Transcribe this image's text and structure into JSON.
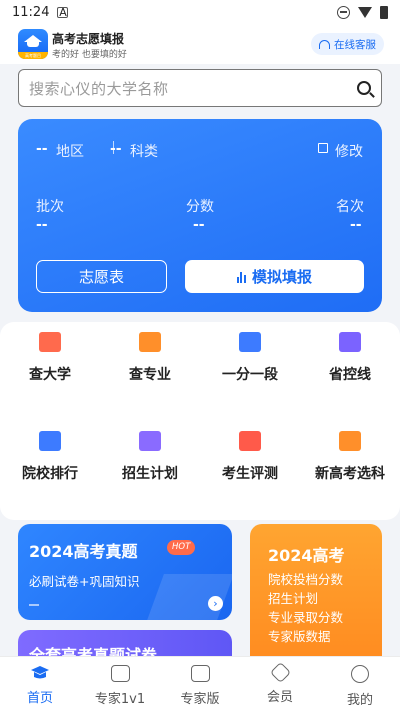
{
  "status_bar": {
    "time": "11:24",
    "badge": "A"
  },
  "header": {
    "title": "高考志愿填报",
    "slogan": "考的好 也要填的好",
    "service_label": "在线客服",
    "logo_ribbon": "高考题目"
  },
  "search": {
    "placeholder": "搜索心仪的大学名称"
  },
  "profile": {
    "region_value": "--",
    "region_label": "地区",
    "subject_value": "--",
    "subject_label": "科类",
    "edit_label": "修改",
    "batch_label": "批次",
    "batch_value": "--",
    "score_label": "分数",
    "score_value": "--",
    "rank_label": "名次",
    "rank_value": "--",
    "wish_button": "志愿表",
    "simulate_button": "模拟填报"
  },
  "features": [
    {
      "label": "查大学",
      "icon": "university-icon",
      "color": "#ff6a4d"
    },
    {
      "label": "查专业",
      "icon": "book-icon",
      "color": "#ff8f2a"
    },
    {
      "label": "一分一段",
      "icon": "segments-icon",
      "color": "#3d7bff"
    },
    {
      "label": "省控线",
      "icon": "monitor-chart-icon",
      "color": "#7b63ff"
    },
    {
      "label": "院校排行",
      "icon": "ranking-icon",
      "color": "#3d7bff"
    },
    {
      "label": "招生计划",
      "icon": "plan-icon",
      "color": "#8a6bff"
    },
    {
      "label": "考生评测",
      "icon": "cube-icon",
      "color": "#ff5a4a"
    },
    {
      "label": "新高考选科",
      "icon": "book-select-icon",
      "color": "#ff8f2a"
    }
  ],
  "promos": {
    "exam": {
      "title": "2024高考真题",
      "badge": "HOT",
      "subtitle": "必刷试卷+巩固知识"
    },
    "full_exam": {
      "title": "全套高考真题试卷"
    },
    "orange": {
      "title": "2024高考",
      "lines": [
        "院校投档分数",
        "招生计划",
        "专业录取分数",
        "专家版数据"
      ]
    }
  },
  "tabbar": [
    {
      "label": "首页",
      "icon": "home-icon",
      "active": true
    },
    {
      "label": "专家1v1",
      "icon": "expert-1v1-icon",
      "active": false
    },
    {
      "label": "专家版",
      "icon": "expert-edition-icon",
      "active": false
    },
    {
      "label": "会员",
      "icon": "vip-icon",
      "active": false
    },
    {
      "label": "我的",
      "icon": "profile-icon",
      "active": false
    }
  ]
}
